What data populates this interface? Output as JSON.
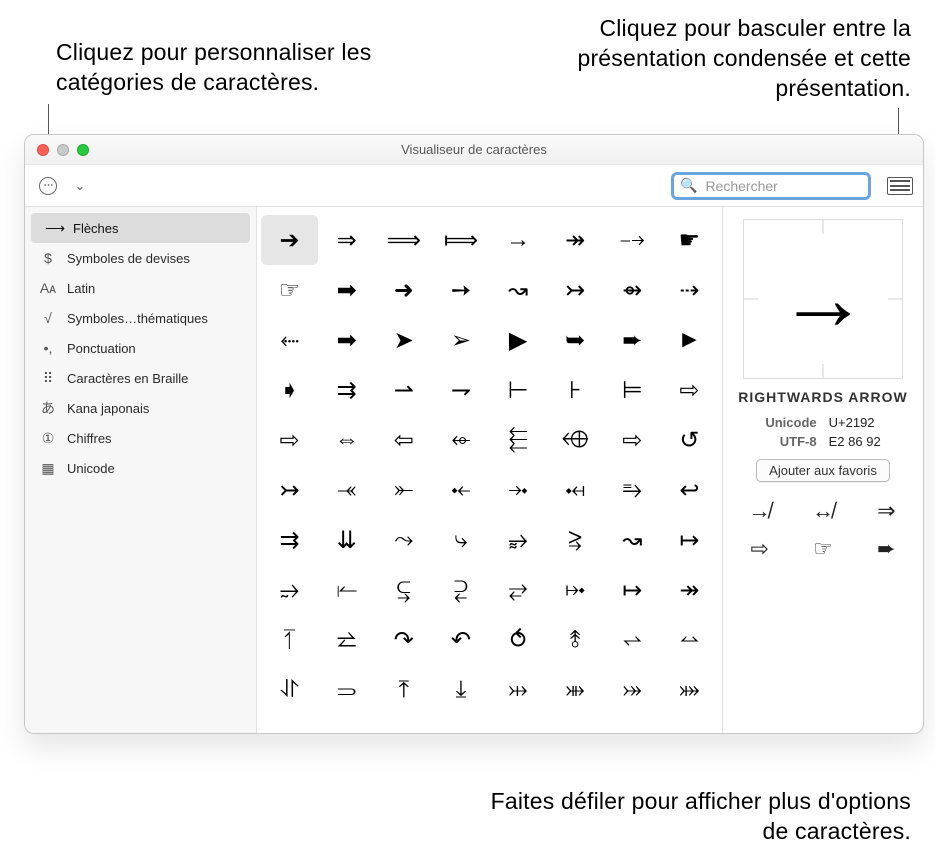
{
  "callouts": {
    "top_left": "Cliquez pour personnaliser les catégories de caractères.",
    "top_right": "Cliquez pour basculer entre la présentation condensée et cette présentation.",
    "bottom_right": "Faites défiler pour afficher plus d'options de caractères."
  },
  "window": {
    "title": "Visualiseur de caractères",
    "search_placeholder": "Rechercher"
  },
  "sidebar": {
    "items": [
      {
        "icon": "⟶",
        "label": "Flèches",
        "active": true
      },
      {
        "icon": "$",
        "label": "Symboles de devises"
      },
      {
        "icon": "Aᴀ",
        "label": "Latin"
      },
      {
        "icon": "√",
        "label": "Symboles…thématiques"
      },
      {
        "icon": "•,",
        "label": "Ponctuation"
      },
      {
        "icon": "⠿",
        "label": "Caractères en Braille"
      },
      {
        "icon": "あ",
        "label": "Kana japonais"
      },
      {
        "icon": "①",
        "label": "Chiffres"
      },
      {
        "icon": "▦",
        "label": "Unicode"
      }
    ]
  },
  "grid": {
    "chars": [
      "➔",
      "⇒",
      "⟹",
      "⟾",
      "→",
      "↠",
      "⤍",
      "☛",
      "☞",
      "➡",
      "➜",
      "➙",
      "↝",
      "↣",
      "⇴",
      "⇢",
      "⬸",
      "➡",
      "➤",
      "➢",
      "▶",
      "➥",
      "➨",
      "►",
      "➧",
      "⇉",
      "⇀",
      "⇁",
      "⊢",
      "⊦",
      "⊨",
      "⇨",
      "⇨",
      "⇔",
      "⇦",
      "⬰",
      "⬱",
      "⬲",
      "⇨",
      "↺",
      "↣",
      "⤛",
      "⤜",
      "⤝",
      "⤞",
      "⤟",
      "⥱",
      "↩",
      "⇉",
      "⇊",
      "⤳",
      "⤷",
      "⥵",
      "⥸",
      "↝",
      "↦",
      "⥴",
      "⥒",
      "⥹",
      "⥻",
      "⥂",
      "⤠",
      "↦",
      "↠",
      "⥘",
      "⥨",
      "↷",
      "↶",
      "⥀",
      "⥉",
      "⥋",
      "⥎",
      "⥯",
      "⥰",
      "⤒",
      "⤓",
      "⤔",
      "⤕",
      "⤖",
      "⤗"
    ],
    "selected_index": 0
  },
  "detail": {
    "preview_glyph": "→",
    "name": "RIGHTWARDS ARROW",
    "meta": {
      "unicode_label": "Unicode",
      "unicode_value": "U+2192",
      "utf8_label": "UTF-8",
      "utf8_value": "E2 86 92"
    },
    "favorite_button": "Ajouter aux favoris",
    "variants": [
      "↛",
      "↮",
      "⇒",
      "⇨",
      "☞",
      "➨"
    ]
  }
}
